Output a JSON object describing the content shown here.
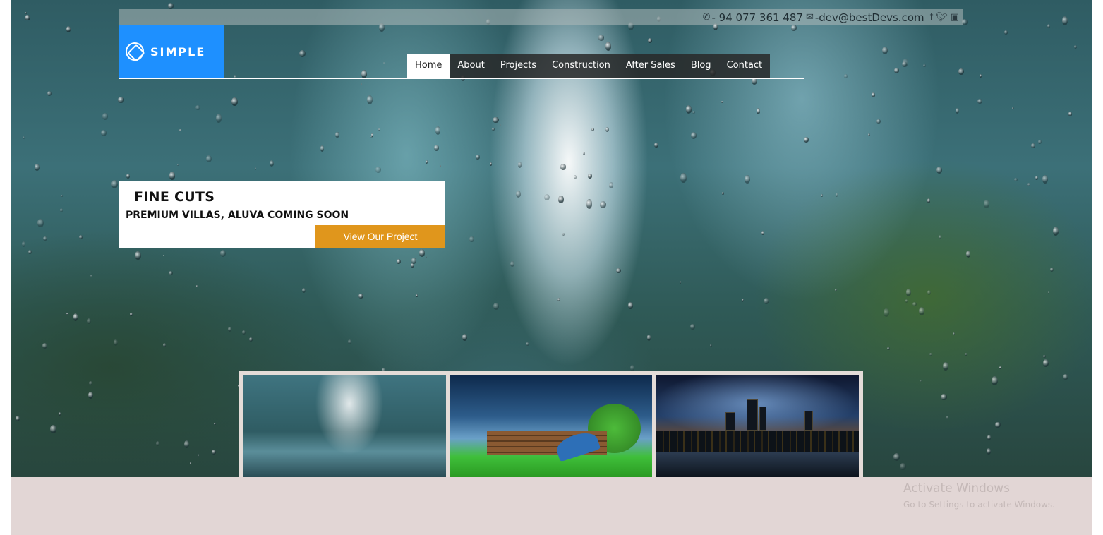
{
  "topbar": {
    "phone_icon": "phone-icon",
    "phone": "- 94 077 361 487",
    "email_icon": "mail-icon",
    "email": "-dev@bestDevs.com",
    "social_icons": [
      "facebook-icon",
      "twitter-icon",
      "youtube-icon"
    ]
  },
  "brand": {
    "name": "SIMPLE",
    "color": "#1e90ff"
  },
  "nav": {
    "items": [
      {
        "label": "Home"
      },
      {
        "label": "About"
      },
      {
        "label": "Projects"
      },
      {
        "label": "Construction"
      },
      {
        "label": "After Sales"
      },
      {
        "label": "Blog"
      },
      {
        "label": "Contact"
      }
    ],
    "active": "Home"
  },
  "promo": {
    "title": "FINE CUTS",
    "subtitle": "PREMIUM VILLAS, ALUVA COMING SOON",
    "button_label": "View Our Project",
    "button_color": "#e0961c"
  },
  "watermark": {
    "title": "Activate Windows",
    "subtitle": "Go to Settings to activate Windows."
  }
}
